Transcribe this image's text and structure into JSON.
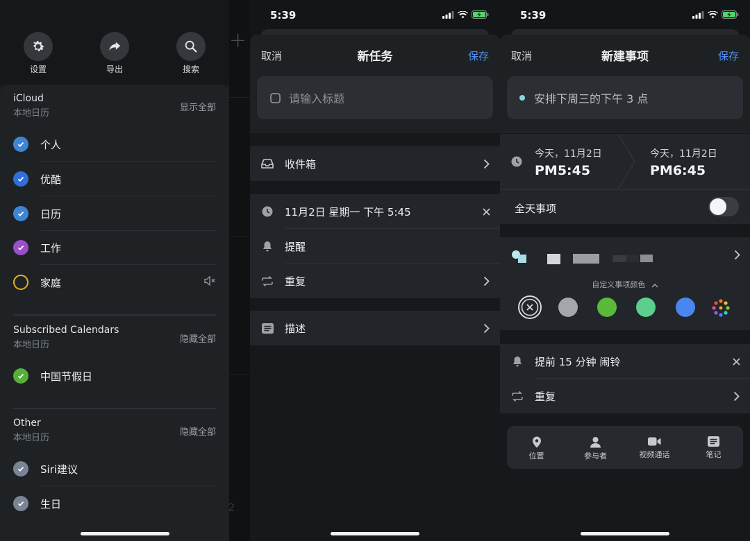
{
  "colors": {
    "accent": "#4f8ff0",
    "check_personal": "#3d86d4",
    "check_youku": "#2f70d8",
    "check_calendar": "#3d86d4",
    "check_work": "#9b4fc8",
    "check_home": "#e1b12c",
    "check_holiday": "#55b03a",
    "check_siri": "#7a8494",
    "check_birthday": "#7a8494"
  },
  "drawer": {
    "tools": [
      {
        "label": "设置",
        "icon": "gear-icon"
      },
      {
        "label": "导出",
        "icon": "share-arrow-icon"
      },
      {
        "label": "搜索",
        "icon": "search-icon"
      }
    ],
    "icloud": {
      "title": "iCloud",
      "subtitle": "本地日历",
      "action": "显示全部",
      "items": [
        "个人",
        "优酷",
        "日历",
        "工作",
        "家庭"
      ]
    },
    "subscribed": {
      "title": "Subscribed Calendars",
      "subtitle": "本地日历",
      "action": "隐藏全部",
      "items": [
        "中国节假日"
      ]
    },
    "other": {
      "title": "Other",
      "subtitle": "本地日历",
      "action": "隐藏全部",
      "items": [
        "Siri建议",
        "生日"
      ]
    },
    "behind_number": "2"
  },
  "task": {
    "time": "5:39",
    "cancel": "取消",
    "title": "新任务",
    "save": "保存",
    "placeholder": "请输入标题",
    "inbox": "收件箱",
    "date": "11月2日 星期一 下午 5:45",
    "reminder": "提醒",
    "repeat": "重复",
    "description": "描述"
  },
  "event": {
    "time": "5:39",
    "cancel": "取消",
    "title": "新建事项",
    "save": "保存",
    "input_text": "安排下周三的下午 3 点",
    "start_day": "今天，11月2日",
    "start_time": "PM5:45",
    "end_day": "今天，11月2日",
    "end_time": "PM6:45",
    "all_day": "全天事项",
    "all_day_on": false,
    "custom_color": "自定义事项颜色",
    "swatches": [
      "#a3a6ab",
      "#5ab93a",
      "#5bd08c",
      "#4a86f0"
    ],
    "alarm": "提前 15 分钟 闹铃",
    "repeat": "重复",
    "bottom": [
      {
        "label": "位置",
        "icon": "location-pin-icon"
      },
      {
        "label": "参与者",
        "icon": "person-icon"
      },
      {
        "label": "视频通话",
        "icon": "video-camera-icon"
      },
      {
        "label": "笔记",
        "icon": "note-icon"
      }
    ]
  }
}
